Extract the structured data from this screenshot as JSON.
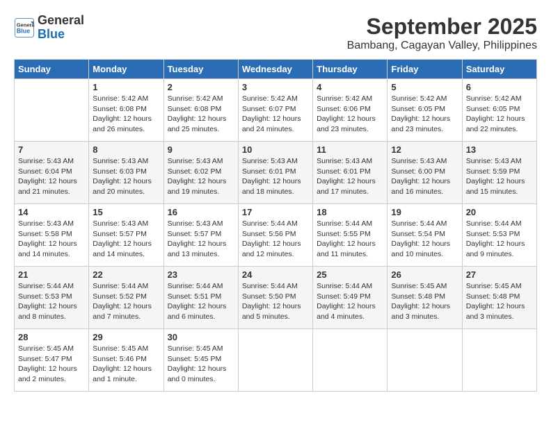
{
  "header": {
    "logo_line1": "General",
    "logo_line2": "Blue",
    "month": "September 2025",
    "location": "Bambang, Cagayan Valley, Philippines"
  },
  "days_of_week": [
    "Sunday",
    "Monday",
    "Tuesday",
    "Wednesday",
    "Thursday",
    "Friday",
    "Saturday"
  ],
  "weeks": [
    [
      {
        "day": "",
        "info": ""
      },
      {
        "day": "1",
        "info": "Sunrise: 5:42 AM\nSunset: 6:08 PM\nDaylight: 12 hours\nand 26 minutes."
      },
      {
        "day": "2",
        "info": "Sunrise: 5:42 AM\nSunset: 6:08 PM\nDaylight: 12 hours\nand 25 minutes."
      },
      {
        "day": "3",
        "info": "Sunrise: 5:42 AM\nSunset: 6:07 PM\nDaylight: 12 hours\nand 24 minutes."
      },
      {
        "day": "4",
        "info": "Sunrise: 5:42 AM\nSunset: 6:06 PM\nDaylight: 12 hours\nand 23 minutes."
      },
      {
        "day": "5",
        "info": "Sunrise: 5:42 AM\nSunset: 6:05 PM\nDaylight: 12 hours\nand 23 minutes."
      },
      {
        "day": "6",
        "info": "Sunrise: 5:42 AM\nSunset: 6:05 PM\nDaylight: 12 hours\nand 22 minutes."
      }
    ],
    [
      {
        "day": "7",
        "info": "Sunrise: 5:43 AM\nSunset: 6:04 PM\nDaylight: 12 hours\nand 21 minutes."
      },
      {
        "day": "8",
        "info": "Sunrise: 5:43 AM\nSunset: 6:03 PM\nDaylight: 12 hours\nand 20 minutes."
      },
      {
        "day": "9",
        "info": "Sunrise: 5:43 AM\nSunset: 6:02 PM\nDaylight: 12 hours\nand 19 minutes."
      },
      {
        "day": "10",
        "info": "Sunrise: 5:43 AM\nSunset: 6:01 PM\nDaylight: 12 hours\nand 18 minutes."
      },
      {
        "day": "11",
        "info": "Sunrise: 5:43 AM\nSunset: 6:01 PM\nDaylight: 12 hours\nand 17 minutes."
      },
      {
        "day": "12",
        "info": "Sunrise: 5:43 AM\nSunset: 6:00 PM\nDaylight: 12 hours\nand 16 minutes."
      },
      {
        "day": "13",
        "info": "Sunrise: 5:43 AM\nSunset: 5:59 PM\nDaylight: 12 hours\nand 15 minutes."
      }
    ],
    [
      {
        "day": "14",
        "info": "Sunrise: 5:43 AM\nSunset: 5:58 PM\nDaylight: 12 hours\nand 14 minutes."
      },
      {
        "day": "15",
        "info": "Sunrise: 5:43 AM\nSunset: 5:57 PM\nDaylight: 12 hours\nand 14 minutes."
      },
      {
        "day": "16",
        "info": "Sunrise: 5:43 AM\nSunset: 5:57 PM\nDaylight: 12 hours\nand 13 minutes."
      },
      {
        "day": "17",
        "info": "Sunrise: 5:44 AM\nSunset: 5:56 PM\nDaylight: 12 hours\nand 12 minutes."
      },
      {
        "day": "18",
        "info": "Sunrise: 5:44 AM\nSunset: 5:55 PM\nDaylight: 12 hours\nand 11 minutes."
      },
      {
        "day": "19",
        "info": "Sunrise: 5:44 AM\nSunset: 5:54 PM\nDaylight: 12 hours\nand 10 minutes."
      },
      {
        "day": "20",
        "info": "Sunrise: 5:44 AM\nSunset: 5:53 PM\nDaylight: 12 hours\nand 9 minutes."
      }
    ],
    [
      {
        "day": "21",
        "info": "Sunrise: 5:44 AM\nSunset: 5:53 PM\nDaylight: 12 hours\nand 8 minutes."
      },
      {
        "day": "22",
        "info": "Sunrise: 5:44 AM\nSunset: 5:52 PM\nDaylight: 12 hours\nand 7 minutes."
      },
      {
        "day": "23",
        "info": "Sunrise: 5:44 AM\nSunset: 5:51 PM\nDaylight: 12 hours\nand 6 minutes."
      },
      {
        "day": "24",
        "info": "Sunrise: 5:44 AM\nSunset: 5:50 PM\nDaylight: 12 hours\nand 5 minutes."
      },
      {
        "day": "25",
        "info": "Sunrise: 5:44 AM\nSunset: 5:49 PM\nDaylight: 12 hours\nand 4 minutes."
      },
      {
        "day": "26",
        "info": "Sunrise: 5:45 AM\nSunset: 5:48 PM\nDaylight: 12 hours\nand 3 minutes."
      },
      {
        "day": "27",
        "info": "Sunrise: 5:45 AM\nSunset: 5:48 PM\nDaylight: 12 hours\nand 3 minutes."
      }
    ],
    [
      {
        "day": "28",
        "info": "Sunrise: 5:45 AM\nSunset: 5:47 PM\nDaylight: 12 hours\nand 2 minutes."
      },
      {
        "day": "29",
        "info": "Sunrise: 5:45 AM\nSunset: 5:46 PM\nDaylight: 12 hours\nand 1 minute."
      },
      {
        "day": "30",
        "info": "Sunrise: 5:45 AM\nSunset: 5:45 PM\nDaylight: 12 hours\nand 0 minutes."
      },
      {
        "day": "",
        "info": ""
      },
      {
        "day": "",
        "info": ""
      },
      {
        "day": "",
        "info": ""
      },
      {
        "day": "",
        "info": ""
      }
    ]
  ]
}
